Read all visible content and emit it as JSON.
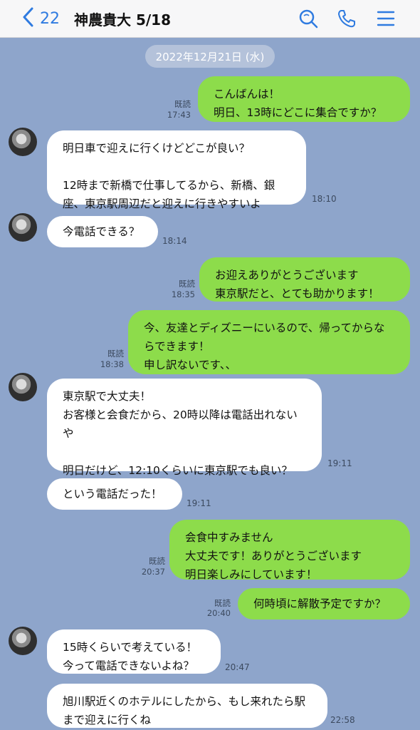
{
  "header": {
    "back_count": "22",
    "title": "神農貴大 5/18",
    "icons": [
      "search-icon",
      "phone-icon",
      "menu-icon"
    ]
  },
  "chat": {
    "date": "2022年12月21日 (水)",
    "read_label": "既読",
    "messages": [
      {
        "dir": "out",
        "text": "こんばんは！\n明日、13時にどこに集合ですか？",
        "emoji": [
          1
        ],
        "time": "17:43"
      },
      {
        "dir": "in",
        "text": "明日車で迎えに行くけどどこが良い？\n\n12時まで新橋で仕事してるから、新橋、銀座、東京駅周辺だと迎えに行きやすいよ",
        "time": "18:10"
      },
      {
        "dir": "in",
        "text": "今電話できる？",
        "time": "18:14"
      },
      {
        "dir": "out",
        "text": "お迎えありがとうございます\n東京駅だと、とても助かります！",
        "time": "18:35"
      },
      {
        "dir": "out",
        "text": "今、友達とディズニーにいるので、帰ってからならできます！\n申し訳ないです、、",
        "time": "18:38"
      },
      {
        "dir": "in",
        "text": "東京駅で大丈夫！\nお客様と会食だから、20時以降は電話出れないや\n\n明日だけど、12:10くらいに東京駅でも良い？",
        "time": "19:11"
      },
      {
        "dir": "in",
        "text": "という電話だった！",
        "time": "19:11"
      },
      {
        "dir": "out",
        "text": "会食中すみません\n大丈夫です！ありがとうございます\n明日楽しみにしています！",
        "time": "20:37"
      },
      {
        "dir": "out",
        "text": "何時頃に解散予定ですか？",
        "time": "20:40"
      },
      {
        "dir": "in",
        "text": "15時くらいで考えている！\n今って電話できないよね？",
        "time": "20:47"
      },
      {
        "dir": "in",
        "text": "旭川駅近くのホテルにしたから、もし来れたら駅まで迎えに行くね",
        "time": "22:58"
      }
    ]
  },
  "colors": {
    "background": "#8ea5cb",
    "outgoing_bubble": "#8ddc4b",
    "incoming_bubble": "#ffffff",
    "accent": "#2f7be0"
  }
}
